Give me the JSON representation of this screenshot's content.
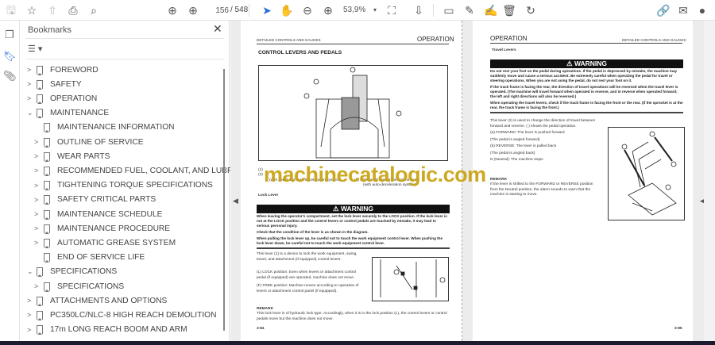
{
  "toolbar": {
    "page_current": "156",
    "page_total": "/ 548",
    "zoom": "53,9%",
    "icons": [
      "save-icon",
      "star-icon",
      "upload-icon",
      "print-icon",
      "search-zoom-icon",
      "prev-page-icon",
      "next-page-icon",
      "select-cursor-icon",
      "hand-icon",
      "zoom-out-icon",
      "zoom-in-icon",
      "fit-page-icon",
      "scroll-mode-icon",
      "comment-icon",
      "pen-icon",
      "sign-icon",
      "delete-icon",
      "rotate-icon",
      "share-link-icon",
      "email-icon",
      "account-icon"
    ]
  },
  "panel": {
    "title": "Bookmarks",
    "close": "✕",
    "options": "☰ ▾",
    "items": [
      {
        "label": "FOREWORD",
        "level": 0,
        "chev": ">"
      },
      {
        "label": "SAFETY",
        "level": 0,
        "chev": ">"
      },
      {
        "label": "OPERATION",
        "level": 0,
        "chev": ">"
      },
      {
        "label": "MAINTENANCE",
        "level": 0,
        "chev": "v"
      },
      {
        "label": "MAINTENANCE INFORMATION",
        "level": 1,
        "chev": ""
      },
      {
        "label": "OUTLINE OF SERVICE",
        "level": 1,
        "chev": ">"
      },
      {
        "label": "WEAR PARTS",
        "level": 1,
        "chev": ">"
      },
      {
        "label": "RECOMMENDED FUEL, COOLANT, AND LUBRICANT",
        "level": 1,
        "chev": ">"
      },
      {
        "label": "TIGHTENING TORQUE SPECIFICATIONS",
        "level": 1,
        "chev": ">"
      },
      {
        "label": "SAFETY CRITICAL PARTS",
        "level": 1,
        "chev": ">"
      },
      {
        "label": "MAINTENANCE SCHEDULE",
        "level": 1,
        "chev": ">"
      },
      {
        "label": "MAINTENANCE PROCEDURE",
        "level": 1,
        "chev": ">"
      },
      {
        "label": "AUTOMATIC GREASE SYSTEM",
        "level": 1,
        "chev": ">"
      },
      {
        "label": "END OF SERVICE LIFE",
        "level": 1,
        "chev": ""
      },
      {
        "label": "SPECIFICATIONS",
        "level": 0,
        "chev": "v"
      },
      {
        "label": "SPECIFICATIONS",
        "level": 1,
        "chev": ">"
      },
      {
        "label": "ATTACHMENTS AND OPTIONS",
        "level": 0,
        "chev": ">"
      },
      {
        "label": "PC350LC/NLC-8 HIGH REACH DEMOLITION",
        "level": 0,
        "chev": ">"
      },
      {
        "label": "17m LONG REACH BOOM AND ARM",
        "level": 0,
        "chev": ">"
      }
    ]
  },
  "left_page": {
    "hdr_small": "DETAILED CONTROLS AND GAUGES",
    "hdr_big": "OPERATION",
    "title": "CONTROL LEVERS AND PEDALS",
    "captions": [
      "(1)",
      "(2)",
      "(with pedal and auto-deceleration system)",
      "(4)  Right work equipment control lever",
      "(with auto-deceleration system)"
    ],
    "subhead": "Lock Lever",
    "warning": "⚠ WARNING",
    "warn_items": [
      "When leaving the operator's compartment, set the lock lever securely to the LOCK position. If the lock lever is not at the LOCK position and the control levers or control pedals are touched by mistake, it may lead to serious personal injury.",
      "Check that the condition of the lever is as shown in the diagram.",
      "When pulling the lock lever up, be careful not to touch the work equipment control lever. When pushing the lock lever down, be careful not to touch the work equipment control lever."
    ],
    "para1": "This lever (1) is a device to lock the work equipment, swing, travel, and attachment (if equipped) control levers.",
    "para2": "(L) LOCK position: Even when levers or attachment control pedal (if equipped) are operated, machine does not move.",
    "para3": "(F) FREE position: Machine moves according to operation of levers or attachment control panel (if equipped).",
    "remark": "REMARK",
    "remark_text": "This lock lever is of hydraulic lock type. Accordingly, when it is in the lock position (L), the control levers or control pedals move but the machine does not move.",
    "page_no": "3-84"
  },
  "right_page": {
    "hdr_big": "OPERATION",
    "hdr_small": "DETAILED CONTROLS AND GAUGES",
    "subhead": "Travel Levers",
    "warning": "⚠ WARNING",
    "warn_items": [
      "Do not rest your foot on the pedal during operations. If the pedal is depressed by mistake, the machine may suddenly move and cause a serious accident. Be extremely careful when operating the pedal for travel or steering operations. When you are not using the pedal, do not rest your foot on it.",
      "If the track frame is facing the rear, the direction of travel operations will be reversed when the travel lever is operated. (The machine will travel forward when operated in reverse, and in reverse when operated forward; the left and right directions will also be reversed.)",
      "When operating the travel levers, check if the track frame is facing the front or the rear. (If the sprocket is at the rear, the track frame is facing the front.)"
    ],
    "lines": [
      "This lever (2) is used to change the direction of travel between forward and reverse. ( ) shows the pedal operation.",
      "(a) FORWARD: The lever is pushed forward",
      "(The pedal is angled forward)",
      "(b) REVERSE: The lever is pulled back",
      "(The pedal is angled back)",
      "N (Neutral): The machine stops"
    ],
    "remark": "REMARK",
    "remark_text": "If the lever is shifted to the FORWARD or REVERSE position from the Neutral position, the alarm sounds to warn that the machine is starting to move.",
    "page_no": "3-85"
  },
  "watermark": "machinecatalogic.com"
}
